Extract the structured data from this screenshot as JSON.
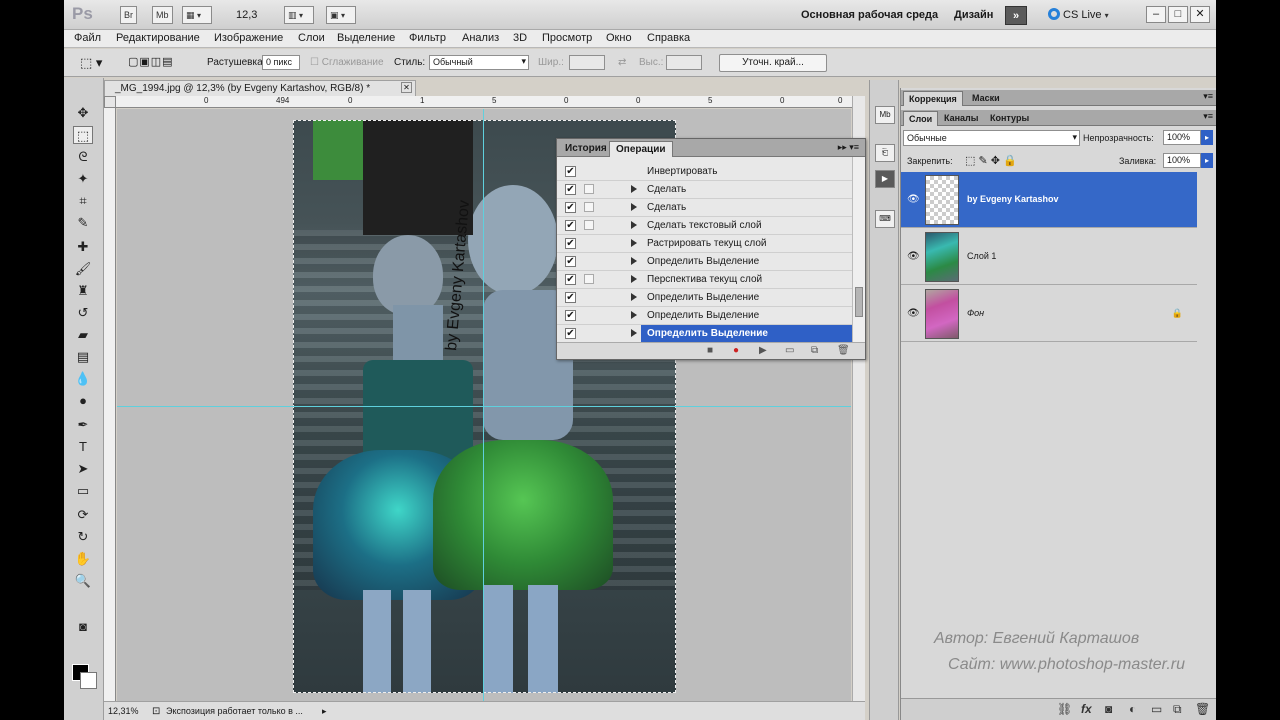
{
  "appbar": {
    "logo": "Ps",
    "btn_br": "Br",
    "btn_mb": "Mb",
    "zoom": "12,3",
    "workspace": "Основная рабочая среда",
    "design": "Дизайн",
    "more": "»",
    "cslive": "CS Live",
    "window_buttons": [
      "–",
      "□",
      "✕"
    ]
  },
  "menu": [
    "Файл",
    "Редактирование",
    "Изображение",
    "Слои",
    "Выделение",
    "Фильтр",
    "Анализ",
    "3D",
    "Просмотр",
    "Окно",
    "Справка"
  ],
  "options": {
    "feather_label": "Растушевка:",
    "feather_value": "0 пикс",
    "antialias_label": "Сглаживание",
    "style_label": "Стиль:",
    "style_value": "Обычный",
    "width_label": "Шир.:",
    "height_label": "Выс.:",
    "refine_button": "Уточн. край..."
  },
  "document": {
    "tab_title": "_MG_1994.jpg @ 12,3% (by Evgeny Kartashov, RGB/8) *",
    "watermark": "by Evgeny Kartashov",
    "ruler_numbers": [
      "0",
      "494",
      "0",
      "1",
      "5",
      "0",
      "0",
      "5",
      "0",
      "0"
    ]
  },
  "status": {
    "zoom": "12,31%",
    "message": "Экспозиция работает только в ..."
  },
  "actions_panel": {
    "tabs": [
      "История",
      "Операции"
    ],
    "rows": [
      {
        "label": "Инвертировать",
        "dialog": false,
        "expandable": false,
        "selected": false
      },
      {
        "label": "Сделать",
        "dialog": true,
        "expandable": true,
        "selected": false
      },
      {
        "label": "Сделать",
        "dialog": true,
        "expandable": true,
        "selected": false
      },
      {
        "label": "Сделать текстовый слой",
        "dialog": true,
        "expandable": true,
        "selected": false
      },
      {
        "label": "Растрировать текущ слой",
        "dialog": false,
        "expandable": true,
        "selected": false
      },
      {
        "label": "Определить Выделение",
        "dialog": false,
        "expandable": true,
        "selected": false
      },
      {
        "label": "Перспектива текущ слой",
        "dialog": true,
        "expandable": true,
        "selected": false
      },
      {
        "label": "Определить Выделение",
        "dialog": false,
        "expandable": true,
        "selected": false
      },
      {
        "label": "Определить Выделение",
        "dialog": false,
        "expandable": true,
        "selected": false
      },
      {
        "label": "Определить Выделение",
        "dialog": false,
        "expandable": true,
        "selected": true
      }
    ],
    "footer_icons": [
      "stop-icon",
      "record-icon",
      "play-icon",
      "new-set-icon",
      "new-action-icon",
      "delete-icon"
    ]
  },
  "right_panel": {
    "top_tabs": [
      "Коррекция",
      "Маски"
    ],
    "layer_tabs": [
      "Слои",
      "Каналы",
      "Контуры"
    ],
    "blend_mode": "Обычные",
    "opacity_label": "Непрозрачность:",
    "opacity_value": "100%",
    "lock_label": "Закрепить:",
    "fill_label": "Заливка:",
    "fill_value": "100%",
    "layers": [
      {
        "name": "by Evgeny Kartashov",
        "selected": true,
        "locked": false
      },
      {
        "name": "Слой 1",
        "selected": false,
        "locked": false
      },
      {
        "name": "Фон",
        "selected": false,
        "locked": true
      }
    ]
  },
  "credits": {
    "author": "Автор: Евгений Карташов",
    "site": "Сайт: www.photoshop-master.ru"
  },
  "colors": {
    "selection_blue": "#2f60c6",
    "guide": "#5fd0dd",
    "foreground": "#000000",
    "background": "#ffffff"
  }
}
